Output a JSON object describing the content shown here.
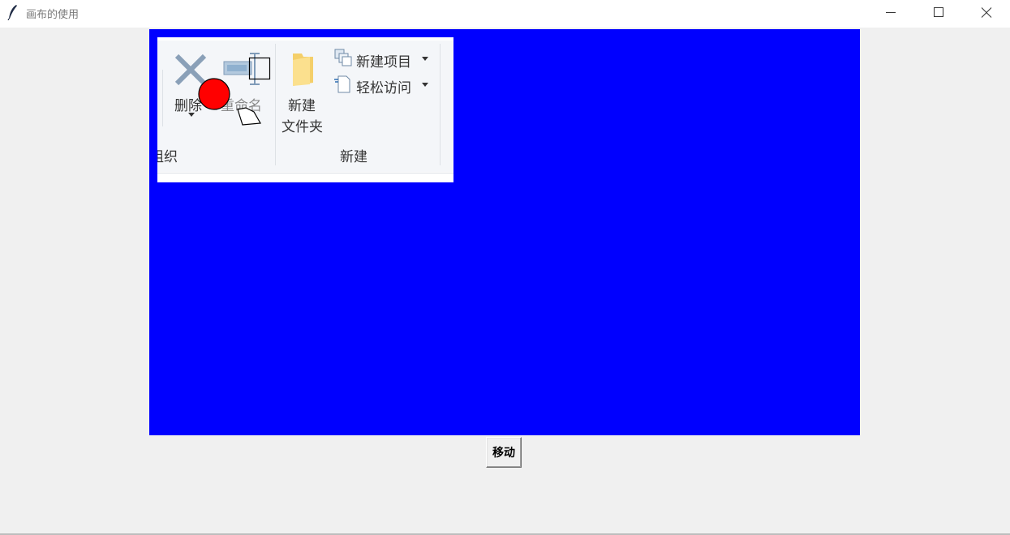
{
  "window": {
    "title": "画布的使用",
    "icons": {
      "app": "feather-icon",
      "minimize": "minimize-icon",
      "maximize": "maximize-icon",
      "close": "close-icon"
    }
  },
  "canvas": {
    "background": "#0000ff",
    "ribbon_image": {
      "delete_label": "删除",
      "rename_label": "重命名",
      "organize_group_label": "组织",
      "new_folder_label_line1": "新建",
      "new_folder_label_line2": "文件夹",
      "new_item_label": "新建项目",
      "easy_access_label": "轻松访问",
      "new_group_label": "新建"
    },
    "shapes": {
      "circle_color": "#ff0000",
      "outline_color": "#000000"
    }
  },
  "controls": {
    "move_button_label": "移动"
  }
}
